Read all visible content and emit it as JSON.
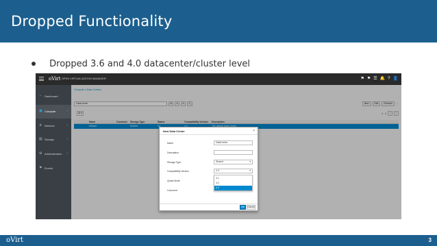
{
  "slide": {
    "title": "Dropped Functionality",
    "bullet": "Dropped 3.6 and 4.0 datacenter/cluster level",
    "footer_logo": "oVirt",
    "page_number": "3"
  },
  "app": {
    "brand": "oVirt",
    "product": "OPEN VIRTUALIZATION MANAGER",
    "top_icons": [
      "bookmark-icon",
      "tag-icon",
      "tasks-icon",
      "bell-icon",
      "help-icon",
      "user-icon"
    ],
    "top_icon_glyphs": [
      "⚑",
      "⚑",
      "☰",
      "🔔",
      "?",
      "👤"
    ],
    "sidebar": [
      {
        "name": "dashboard",
        "label": "Dashboard",
        "icon": "◔",
        "chevron": ""
      },
      {
        "name": "compute",
        "label": "Compute",
        "icon": "▣",
        "chevron": "›",
        "active": true
      },
      {
        "name": "network",
        "label": "Network",
        "icon": "⋔",
        "chevron": "›"
      },
      {
        "name": "storage",
        "label": "Storage",
        "icon": "▤",
        "chevron": "›"
      },
      {
        "name": "administration",
        "label": "Administration",
        "icon": "⚙",
        "chevron": "›"
      },
      {
        "name": "events",
        "label": "Events",
        "icon": "⚑",
        "chevron": ""
      }
    ],
    "breadcrumb": {
      "root": "Compute",
      "sep": "»",
      "current": "Data Centers"
    },
    "search": {
      "value": "DataCenter:"
    },
    "search_controls": [
      "★",
      "▾",
      "✕",
      "🔍"
    ],
    "actions": {
      "new": "New",
      "edit": "Edit",
      "remove": "Remove",
      "kebab": "⋮"
    },
    "settings_label": "⚙ ▾",
    "pager": {
      "range": "1 - 1",
      "prev": "‹",
      "next": "›"
    },
    "grid": {
      "headers": [
        "Name",
        "Comment",
        "Storage Type",
        "Status",
        "Compatibility Version",
        "Description"
      ],
      "row": [
        "Default",
        "",
        "Shared",
        "Up",
        "4.3",
        "The default Data Center"
      ]
    },
    "modal": {
      "title": "New Data Center",
      "close": "×",
      "fields": {
        "name_label": "Name",
        "name_value": "DataCenter",
        "description_label": "Description",
        "description_value": "",
        "storage_type_label": "Storage Type",
        "storage_type_value": "Shared",
        "compat_label": "Compatibility Version",
        "compat_value": "4.3",
        "quota_label": "Quota Mode",
        "comment_label": "Comment"
      },
      "dropdown_options": [
        "4.1",
        "4.2",
        "4.3"
      ],
      "dropdown_selected": "4.3",
      "ok": "OK",
      "cancel": "Cancel"
    }
  }
}
